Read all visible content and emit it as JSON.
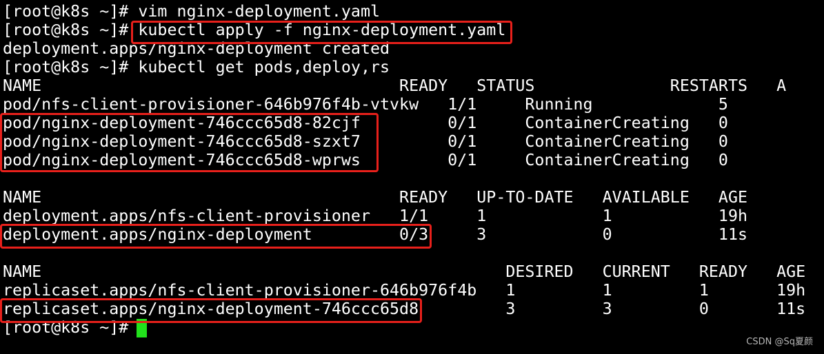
{
  "terminal": {
    "background": "#000000",
    "text_color": "#ffffff",
    "highlight_color": "#e8201b",
    "cursor_color": "#22e11c",
    "lines": [
      "[root@k8s ~]# vim nginx-deployment.yaml",
      "[root@k8s ~]# kubectl apply -f nginx-deployment.yaml",
      "deployment.apps/nginx-deployment created",
      "[root@k8s ~]# kubectl get pods,deploy,rs",
      "NAME                                     READY   STATUS              RESTARTS   A",
      "pod/nfs-client-provisioner-646b976f4b-vtvkw   1/1     Running             5",
      "pod/nginx-deployment-746ccc65d8-82cjf         0/1     ContainerCreating   0",
      "pod/nginx-deployment-746ccc65d8-szxt7         0/1     ContainerCreating   0",
      "pod/nginx-deployment-746ccc65d8-wprws         0/1     ContainerCreating   0",
      "",
      "NAME                                     READY   UP-TO-DATE   AVAILABLE   AGE",
      "deployment.apps/nfs-client-provisioner   1/1     1            1           19h",
      "deployment.apps/nginx-deployment         0/3     3            0           11s",
      "",
      "NAME                                                DESIRED   CURRENT   READY   AGE",
      "replicaset.apps/nfs-client-provisioner-646b976f4b   1         1         1       19h",
      "replicaset.apps/nginx-deployment-746ccc65d8         3         3         0       11s",
      "[root@k8s ~]# "
    ]
  },
  "watermark": "CSDN @Sq夏颜"
}
